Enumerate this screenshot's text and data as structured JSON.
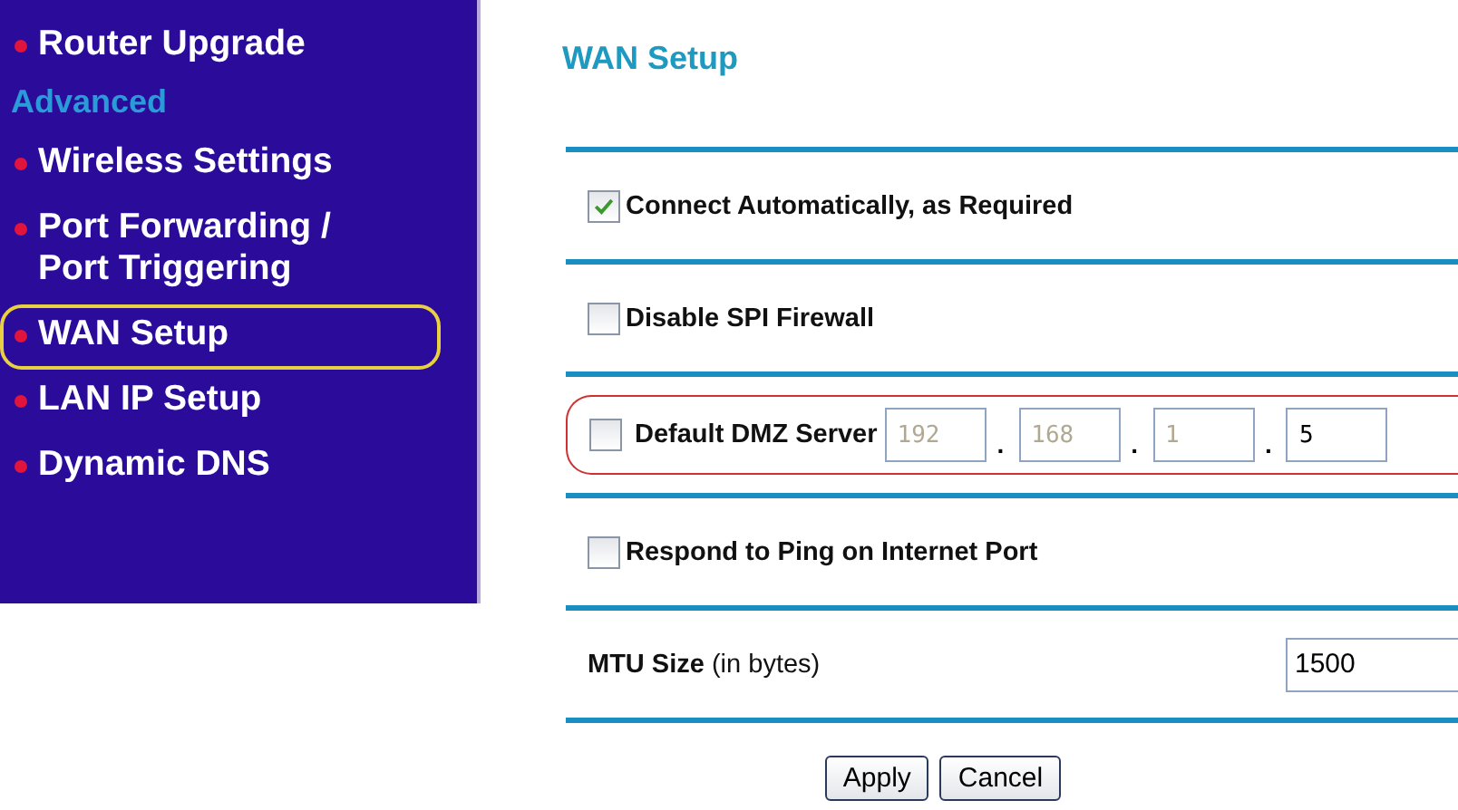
{
  "sidebar": {
    "items": [
      {
        "kind": "link",
        "label": "Router Upgrade",
        "selected": false
      },
      {
        "kind": "heading",
        "label": "Advanced"
      },
      {
        "kind": "link",
        "label": "Wireless Settings",
        "selected": false
      },
      {
        "kind": "link",
        "label": "Port Forwarding / Port Triggering",
        "selected": false
      },
      {
        "kind": "link",
        "label": "WAN Setup",
        "selected": true
      },
      {
        "kind": "link",
        "label": "LAN IP Setup",
        "selected": false
      },
      {
        "kind": "link",
        "label": "Dynamic DNS",
        "selected": false
      }
    ]
  },
  "page": {
    "title": "WAN Setup",
    "rows": [
      {
        "kind": "checkbox",
        "label": "Connect Automatically, as Required",
        "checked": true
      },
      {
        "kind": "checkbox",
        "label": "Disable SPI Firewall",
        "checked": false
      },
      {
        "kind": "dmz",
        "label": "Default DMZ Server",
        "checked": false,
        "separator": ".",
        "fields": [
          {
            "value": "192",
            "disabled": true
          },
          {
            "value": "168",
            "disabled": true
          },
          {
            "value": "1",
            "disabled": true
          },
          {
            "value": "5",
            "disabled": false
          }
        ]
      },
      {
        "kind": "checkbox",
        "label": "Respond to Ping on Internet Port",
        "checked": false
      },
      {
        "kind": "mtu",
        "label": "**MTU Size** (in bytes)",
        "value": "1500"
      }
    ],
    "buttons": [
      "Apply",
      "Cancel"
    ]
  }
}
